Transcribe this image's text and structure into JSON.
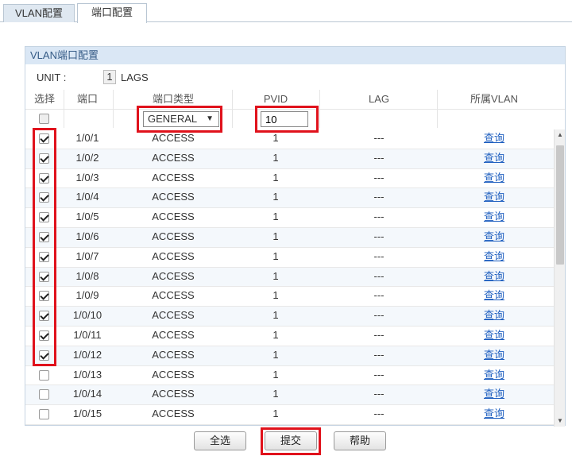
{
  "tabs": [
    {
      "label": "VLAN配置",
      "active": false
    },
    {
      "label": "端口配置",
      "active": true
    }
  ],
  "panel": {
    "title": "VLAN端口配置",
    "unit_label": "UNIT :",
    "unit_value": "1",
    "lags_label": "LAGS"
  },
  "table": {
    "headers": {
      "select": "选择",
      "port": "端口",
      "port_type": "端口类型",
      "pvid": "PVID",
      "lag": "LAG",
      "vlan": "所属VLAN"
    },
    "filter": {
      "port_type_value": "GENERAL",
      "port_type_arrow": "▼",
      "pvid_value": "10"
    },
    "rows": [
      {
        "port": "1/0/1",
        "type": "ACCESS",
        "pvid": "1",
        "lag": "---",
        "action": "查询",
        "checked": true
      },
      {
        "port": "1/0/2",
        "type": "ACCESS",
        "pvid": "1",
        "lag": "---",
        "action": "查询",
        "checked": true
      },
      {
        "port": "1/0/3",
        "type": "ACCESS",
        "pvid": "1",
        "lag": "---",
        "action": "查询",
        "checked": true
      },
      {
        "port": "1/0/4",
        "type": "ACCESS",
        "pvid": "1",
        "lag": "---",
        "action": "查询",
        "checked": true
      },
      {
        "port": "1/0/5",
        "type": "ACCESS",
        "pvid": "1",
        "lag": "---",
        "action": "查询",
        "checked": true
      },
      {
        "port": "1/0/6",
        "type": "ACCESS",
        "pvid": "1",
        "lag": "---",
        "action": "查询",
        "checked": true
      },
      {
        "port": "1/0/7",
        "type": "ACCESS",
        "pvid": "1",
        "lag": "---",
        "action": "查询",
        "checked": true
      },
      {
        "port": "1/0/8",
        "type": "ACCESS",
        "pvid": "1",
        "lag": "---",
        "action": "查询",
        "checked": true
      },
      {
        "port": "1/0/9",
        "type": "ACCESS",
        "pvid": "1",
        "lag": "---",
        "action": "查询",
        "checked": true
      },
      {
        "port": "1/0/10",
        "type": "ACCESS",
        "pvid": "1",
        "lag": "---",
        "action": "查询",
        "checked": true
      },
      {
        "port": "1/0/11",
        "type": "ACCESS",
        "pvid": "1",
        "lag": "---",
        "action": "查询",
        "checked": true
      },
      {
        "port": "1/0/12",
        "type": "ACCESS",
        "pvid": "1",
        "lag": "---",
        "action": "查询",
        "checked": true
      },
      {
        "port": "1/0/13",
        "type": "ACCESS",
        "pvid": "1",
        "lag": "---",
        "action": "查询",
        "checked": false
      },
      {
        "port": "1/0/14",
        "type": "ACCESS",
        "pvid": "1",
        "lag": "---",
        "action": "查询",
        "checked": false
      },
      {
        "port": "1/0/15",
        "type": "ACCESS",
        "pvid": "1",
        "lag": "---",
        "action": "查询",
        "checked": false
      }
    ]
  },
  "buttons": {
    "select_all": "全选",
    "submit": "提交",
    "help": "帮助"
  },
  "colors": {
    "highlight": "#e0121c",
    "link": "#2060c0",
    "panel_title_bg": "#dae7f5"
  }
}
